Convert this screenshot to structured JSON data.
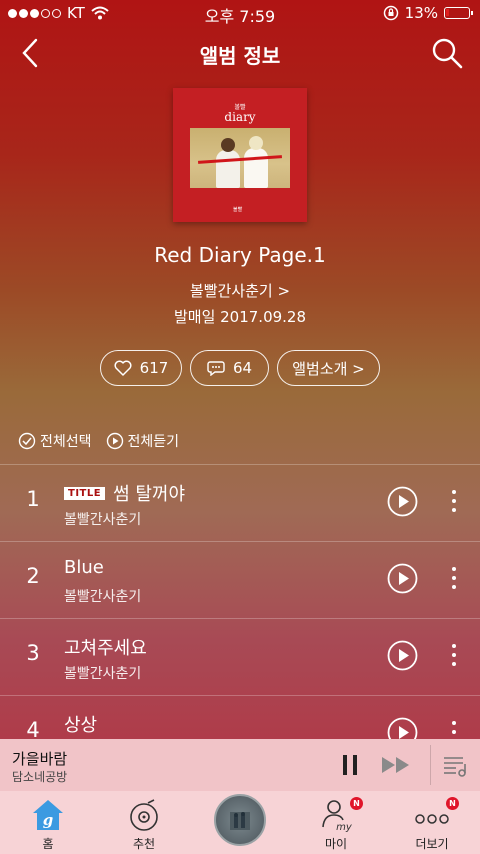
{
  "status_bar": {
    "carrier": "KT",
    "time": "오후 7:59",
    "battery": "13%",
    "battery_level": 0.13
  },
  "header": {
    "title": "앨범 정보",
    "back_icon": "chevron-left-icon",
    "search_icon": "search-icon"
  },
  "album": {
    "art_logo_line1": "볼빨",
    "art_logo_line2": "diary",
    "art_mark": "볼빨",
    "title": "Red Diary Page.1",
    "artist": "볼빨간사춘기 >",
    "release": "발매일 2017.09.28"
  },
  "actions": {
    "likes": "617",
    "comments": "64",
    "intro": "앨범소개 >"
  },
  "toolbar": {
    "select_all": "전체선택",
    "play_all": "전체듣기"
  },
  "tracks": [
    {
      "num": "1",
      "badge": "TITLE",
      "title": "썸 탈꺼야",
      "artist": "볼빨간사춘기"
    },
    {
      "num": "2",
      "badge": "",
      "title": "Blue",
      "artist": "볼빨간사춘기"
    },
    {
      "num": "3",
      "badge": "",
      "title": "고쳐주세요",
      "artist": "볼빨간사춘기"
    },
    {
      "num": "4",
      "badge": "",
      "title": "상상",
      "artist": ""
    }
  ],
  "mini_player": {
    "song": "가을바람",
    "artist": "담소네공방"
  },
  "bottom_nav": {
    "home": "홈",
    "home_icon_letter": "g",
    "recommend": "추천",
    "my": "마이",
    "my_icon_text": "my",
    "more": "더보기",
    "badge": "N"
  },
  "colors": {
    "accent_red": "#b01414",
    "mini_player_bg": "#f1c4c8",
    "nav_bg": "#f7d3d6",
    "home_blue": "#3b9ae1",
    "badge_red": "#e0152a"
  }
}
